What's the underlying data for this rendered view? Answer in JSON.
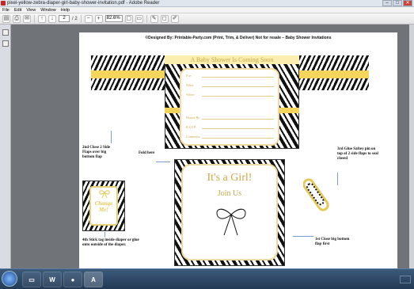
{
  "window": {
    "title": "pixel-yellow-zebra-diaper-girl-baby-shower-invitation.pdf - Adobe Reader",
    "min": "–",
    "max": "□",
    "close": "✕"
  },
  "menu": [
    "File",
    "Edit",
    "View",
    "Window",
    "Help"
  ],
  "toolbar": {
    "page_current": "2",
    "page_total": "/ 2",
    "zoom": "82.6%"
  },
  "page": {
    "header": "©Designed By: Printable-Party.com    (Print, Trim, & Deliver) Not for resale – Baby Shower Invitations",
    "banner": "A Baby Shower Is Coming Soon",
    "form_labels": [
      "For:",
      "When:",
      "Where:",
      "Hosted By:",
      "R.S.V.P.:",
      "Comments:"
    ],
    "its_a_girl": "It's a Girl!",
    "join_us": "Join Us",
    "tag_text": "Change Me!",
    "notes": {
      "side_flaps": "2nd Close 2 Side Flaps over big bottom flap",
      "fold_here": "Fold here",
      "glue_pin": "3rd Glue Saftey pin on top of  2 side flaps to seal closed",
      "stick_tag": "4th Stick tag inside diaper or glue onto outside of the diaper.",
      "close_bottom": "1st Close big bottom flap first"
    }
  },
  "taskbar": {
    "items": [
      "start",
      "explorer",
      "word",
      "firefox",
      "adobe"
    ],
    "word_label": "W"
  },
  "colors": {
    "accent": "#f6d55c",
    "text_gold": "#c9a94a"
  }
}
